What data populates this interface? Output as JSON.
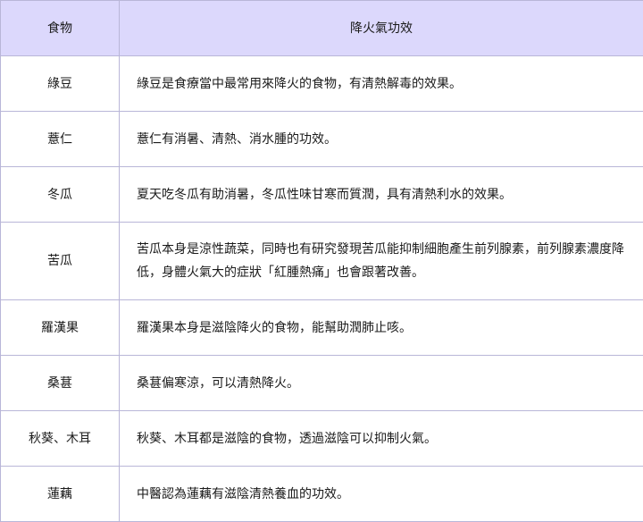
{
  "table": {
    "headers": [
      "食物",
      "降火氣功效"
    ],
    "rows": [
      {
        "food": "綠豆",
        "effect": "綠豆是食療當中最常用來降火的食物，有清熱解毒的效果。"
      },
      {
        "food": "薏仁",
        "effect": "薏仁有消暑、清熱、消水腫的功效。"
      },
      {
        "food": "冬瓜",
        "effect": "夏天吃冬瓜有助消暑，冬瓜性味甘寒而質潤，具有清熱利水的效果。"
      },
      {
        "food": "苦瓜",
        "effect": "苦瓜本身是涼性蔬菜，同時也有研究發現苦瓜能抑制細胞產生前列腺素，前列腺素濃度降低，身體火氣大的症狀「紅腫熱痛」也會跟著改善。"
      },
      {
        "food": "羅漢果",
        "effect": "羅漢果本身是滋陰降火的食物，能幫助潤肺止咳。"
      },
      {
        "food": "桑葚",
        "effect": "桑葚偏寒涼，可以清熱降火。"
      },
      {
        "food": "秋葵、木耳",
        "effect": "秋葵、木耳都是滋陰的食物，透過滋陰可以抑制火氣。"
      },
      {
        "food": "蓮藕",
        "effect": "中醫認為蓮藕有滋陰清熱養血的功效。"
      }
    ]
  },
  "colors": {
    "header_bg": "#dcd8fc",
    "border": "#b9b6d8"
  }
}
